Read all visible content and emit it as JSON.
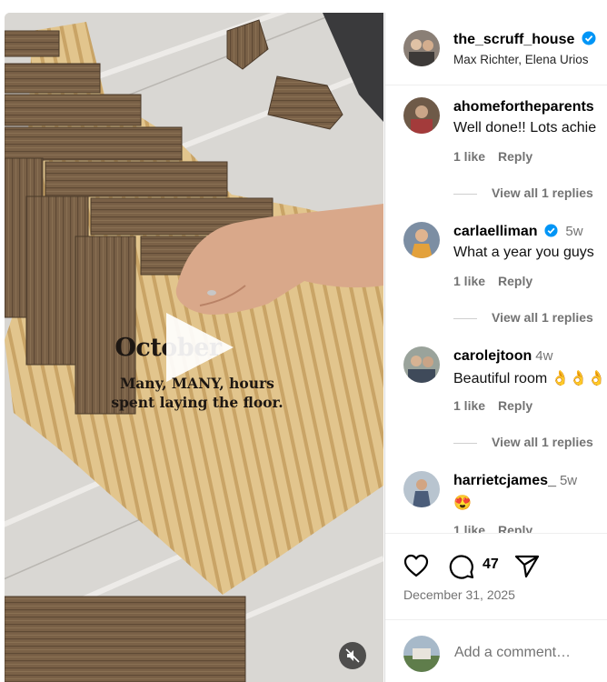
{
  "colors": {
    "verified": "#0095f6",
    "muted_text": "#737373",
    "border": "#dbdbdb"
  },
  "video": {
    "overlay_title": "October",
    "overlay_caption": "Many, MANY, hours spent laying the floor.",
    "play_icon": "play-icon",
    "mute_icon": "speaker-muted-icon"
  },
  "post": {
    "username": "the_scruff_house",
    "verified": true,
    "collaborators": "Max Richter, Elena Urios"
  },
  "comments": [
    {
      "username": "ahomefortheparents",
      "verified": false,
      "time": "",
      "text": "Well done!! Lots achie",
      "likes": "1 like",
      "reply_label": "Reply",
      "view_replies": "View all 1 replies"
    },
    {
      "username": "carlaelliman",
      "verified": true,
      "time": "5w",
      "text": "What a year you guys",
      "likes": "1 like",
      "reply_label": "Reply",
      "view_replies": "View all 1 replies"
    },
    {
      "username": "carolejtoon",
      "verified": false,
      "time": "4w",
      "text": "Beautiful room 👌👌👌",
      "likes": "1 like",
      "reply_label": "Reply",
      "view_replies": "View all 1 replies"
    },
    {
      "username": "harrietcjames_",
      "verified": false,
      "time": "5w",
      "text": "😍",
      "likes": "1 like",
      "reply_label": "Reply",
      "view_replies": ""
    }
  ],
  "actions": {
    "like_icon": "heart-icon",
    "comment_icon": "comment-bubble-icon",
    "share_icon": "paper-plane-icon",
    "comment_count": "47"
  },
  "date": "December 31, 2025",
  "add_comment": {
    "placeholder": "Add a comment…"
  }
}
